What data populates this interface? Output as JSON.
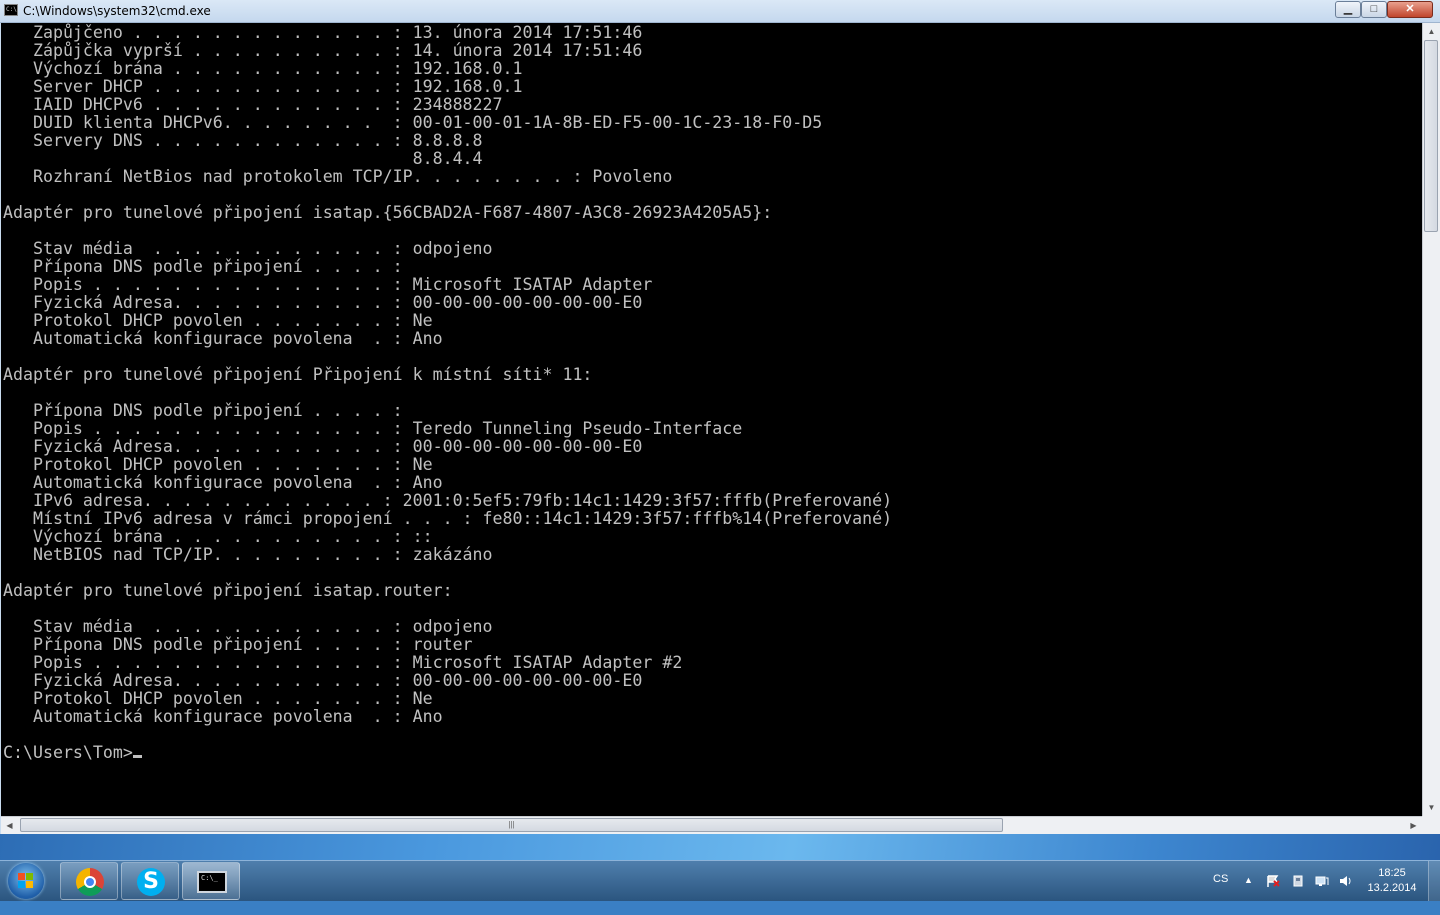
{
  "window": {
    "title": "C:\\Windows\\system32\\cmd.exe",
    "icon_label": "C:\\",
    "buttons": {
      "minimize": "▁",
      "maximize": "□",
      "close": "✕"
    }
  },
  "console": {
    "lines": [
      "   Zapůjčeno . . . . . . . . . . . . . : 13. února 2014 17:51:46",
      "   Zápůjčka vyprší . . . . . . . . . . : 14. února 2014 17:51:46",
      "   Výchozí brána . . . . . . . . . . . : 192.168.0.1",
      "   Server DHCP . . . . . . . . . . . . : 192.168.0.1",
      "   IAID DHCPv6 . . . . . . . . . . . . : 234888227",
      "   DUID klienta DHCPv6. . . . . . . .  : 00-01-00-01-1A-8B-ED-F5-00-1C-23-18-F0-D5",
      "   Servery DNS . . . . . . . . . . . . : 8.8.8.8",
      "                                         8.8.4.4",
      "   Rozhraní NetBios nad protokolem TCP/IP. . . . . . . . : Povoleno",
      "",
      "Adaptér pro tunelové připojení isatap.{56CBAD2A-F687-4807-A3C8-26923A4205A5}:",
      "",
      "   Stav média  . . . . . . . . . . . . : odpojeno",
      "   Přípona DNS podle připojení . . . . :",
      "   Popis . . . . . . . . . . . . . . . : Microsoft ISATAP Adapter",
      "   Fyzická Adresa. . . . . . . . . . . : 00-00-00-00-00-00-00-E0",
      "   Protokol DHCP povolen . . . . . . . : Ne",
      "   Automatická konfigurace povolena  . : Ano",
      "",
      "Adaptér pro tunelové připojení Připojení k místní síti* 11:",
      "",
      "   Přípona DNS podle připojení . . . . :",
      "   Popis . . . . . . . . . . . . . . . : Teredo Tunneling Pseudo-Interface",
      "   Fyzická Adresa. . . . . . . . . . . : 00-00-00-00-00-00-00-E0",
      "   Protokol DHCP povolen . . . . . . . : Ne",
      "   Automatická konfigurace povolena  . : Ano",
      "   IPv6 adresa. . . . . . . . . . . . : 2001:0:5ef5:79fb:14c1:1429:3f57:fffb(Preferované)",
      "   Místní IPv6 adresa v rámci propojení . . . : fe80::14c1:1429:3f57:fffb%14(Preferované)",
      "   Výchozí brána . . . . . . . . . . . : ::",
      "   NetBIOS nad TCP/IP. . . . . . . . . : zakázáno",
      "",
      "Adaptér pro tunelové připojení isatap.router:",
      "",
      "   Stav média  . . . . . . . . . . . . : odpojeno",
      "   Přípona DNS podle připojení . . . . : router",
      "   Popis . . . . . . . . . . . . . . . : Microsoft ISATAP Adapter #2",
      "   Fyzická Adresa. . . . . . . . . . . : 00-00-00-00-00-00-00-E0",
      "   Protokol DHCP povolen . . . . . . . : Ne",
      "   Automatická konfigurace povolena  . : Ano",
      ""
    ],
    "prompt": "C:\\Users\\Tom>"
  },
  "scrollbars": {
    "horizontal_grip": "|||"
  },
  "taskbar": {
    "pinned": [
      {
        "name": "chrome-icon"
      },
      {
        "name": "skype-icon",
        "glyph": "S"
      },
      {
        "name": "cmd-icon",
        "glyph": "C:\\_"
      }
    ],
    "tray": {
      "language": "CS",
      "show_hidden": "▲",
      "icons": [
        "action-center-flag-icon",
        "usb-device-icon",
        "network-icon",
        "volume-icon"
      ]
    },
    "clock": {
      "time": "18:25",
      "date": "13.2.2014"
    }
  },
  "colors": {
    "console_bg": "#000000",
    "console_text": "#c0c0c0",
    "taskbar": "#3b6b99",
    "close_button": "#c0452c"
  }
}
